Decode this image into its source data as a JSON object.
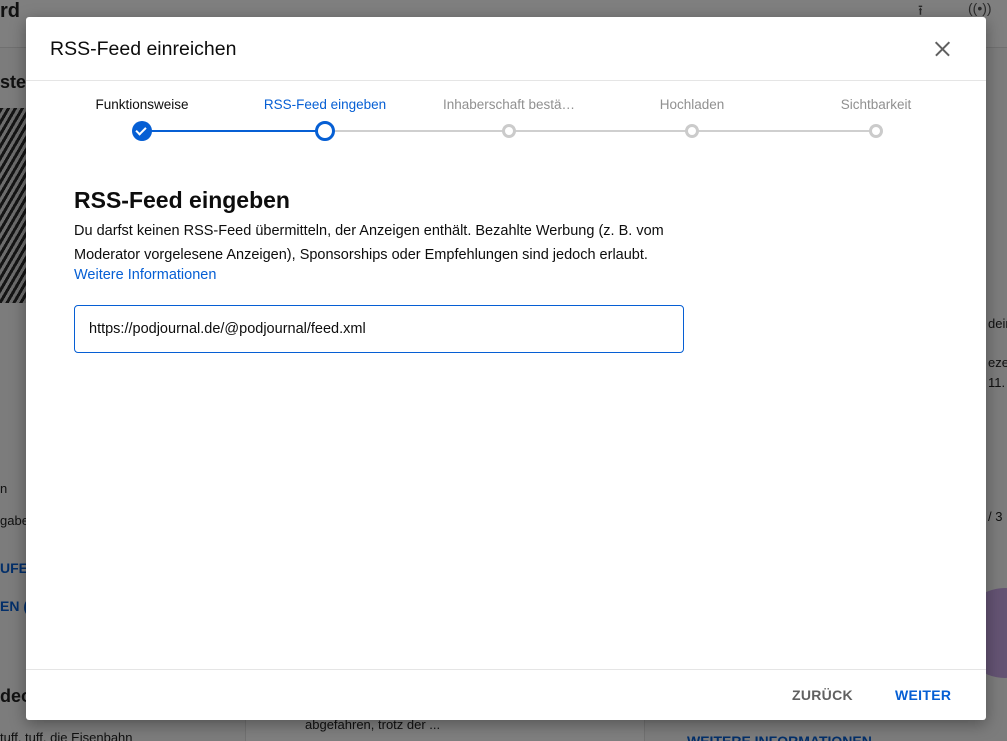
{
  "background": {
    "header_title_fragment": "rd",
    "left_fragments": [
      "ster",
      "n",
      "gabe",
      "UFE",
      "EN (",
      "deos",
      "tuff, tuff, die Eisenbahn"
    ],
    "center_fragment": "abgefahren, trotz der ...",
    "right_fragments": [
      "dein",
      "ezeig",
      "11.",
      "/ 3",
      "WEITERE INFORMATIONEN"
    ]
  },
  "dialog": {
    "title": "RSS-Feed einreichen",
    "close_icon": "close-icon"
  },
  "stepper": {
    "steps": [
      {
        "label": "Funktionsweise",
        "state": "done"
      },
      {
        "label": "RSS-Feed eingeben",
        "state": "active"
      },
      {
        "label": "Inhaberschaft bestä…",
        "state": "pending"
      },
      {
        "label": "Hochladen",
        "state": "pending"
      },
      {
        "label": "Sichtbarkeit",
        "state": "pending"
      }
    ]
  },
  "content": {
    "heading": "RSS-Feed eingeben",
    "description": "Du darfst keinen RSS-Feed übermitteln, der Anzeigen enthält. Bezahlte Werbung (z. B. vom Moderator vorgelesene Anzeigen), Sponsorships oder Empfehlungen sind jedoch erlaubt.",
    "more_info_link": "Weitere Informationen",
    "rss_input_value": "https://podjournal.de/@podjournal/feed.xml"
  },
  "footer": {
    "back_label": "ZURÜCK",
    "next_label": "WEITER"
  },
  "colors": {
    "accent": "#065fd4",
    "muted": "#909090"
  }
}
